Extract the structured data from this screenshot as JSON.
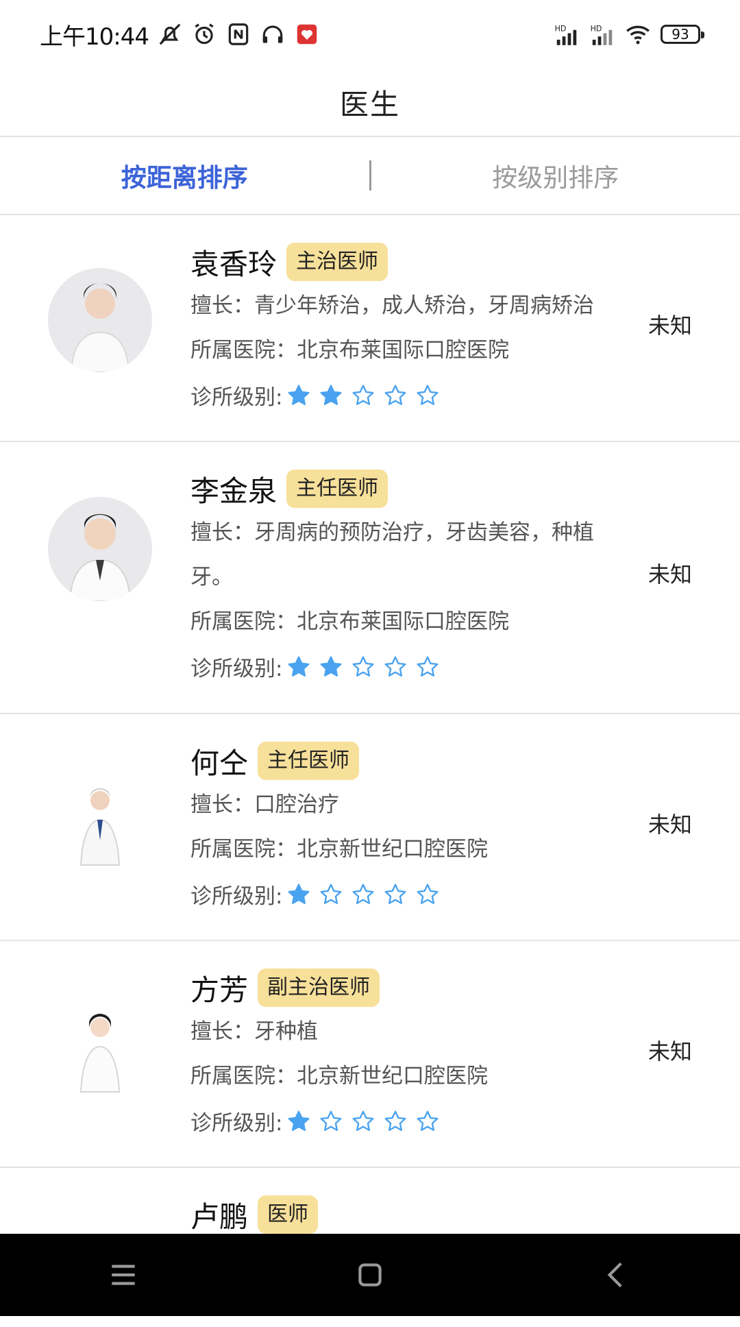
{
  "status_bar": {
    "time": "上午10:44",
    "battery": "93",
    "icons": [
      "mute-icon",
      "alarm-icon",
      "nfc-icon",
      "headphone-icon",
      "app-notification-icon",
      "signal-hd-icon",
      "signal-hd-icon",
      "wifi-icon",
      "battery-icon"
    ]
  },
  "header": {
    "title": "医生"
  },
  "tabs": [
    {
      "label": "按距离排序",
      "active": true
    },
    {
      "label": "按级别排序",
      "active": false
    }
  ],
  "doctors": [
    {
      "name": "袁香玲",
      "title": "主治医师",
      "specialty": "擅长：青少年矫治，成人矫治，牙周病矫治",
      "hospital": "所属医院：北京布莱国际口腔医院",
      "rating_label": "诊所级别:",
      "rating": 2,
      "rating_max": 5,
      "status": "未知"
    },
    {
      "name": "李金泉",
      "title": "主任医师",
      "specialty_line1": "擅长：牙周病的预防治疗，牙齿美容，种植",
      "specialty_line2": "牙。",
      "hospital": "所属医院：北京布莱国际口腔医院",
      "rating_label": "诊所级别:",
      "rating": 2,
      "rating_max": 5,
      "status": "未知"
    },
    {
      "name": "何仝",
      "title": "主任医师",
      "specialty": "擅长：口腔治疗",
      "hospital": "所属医院：北京新世纪口腔医院",
      "rating_label": "诊所级别:",
      "rating": 1,
      "rating_max": 5,
      "status": "未知"
    },
    {
      "name": "方芳",
      "title": "副主治医师",
      "specialty": "擅长：牙种植",
      "hospital": "所属医院：北京新世纪口腔医院",
      "rating_label": "诊所级别:",
      "rating": 1,
      "rating_max": 5,
      "status": "未知"
    },
    {
      "name": "卢鹏",
      "title": "医师"
    }
  ],
  "colors": {
    "accent": "#3c63d8",
    "badge": "#f7e09a",
    "star": "#4aa3ef"
  }
}
